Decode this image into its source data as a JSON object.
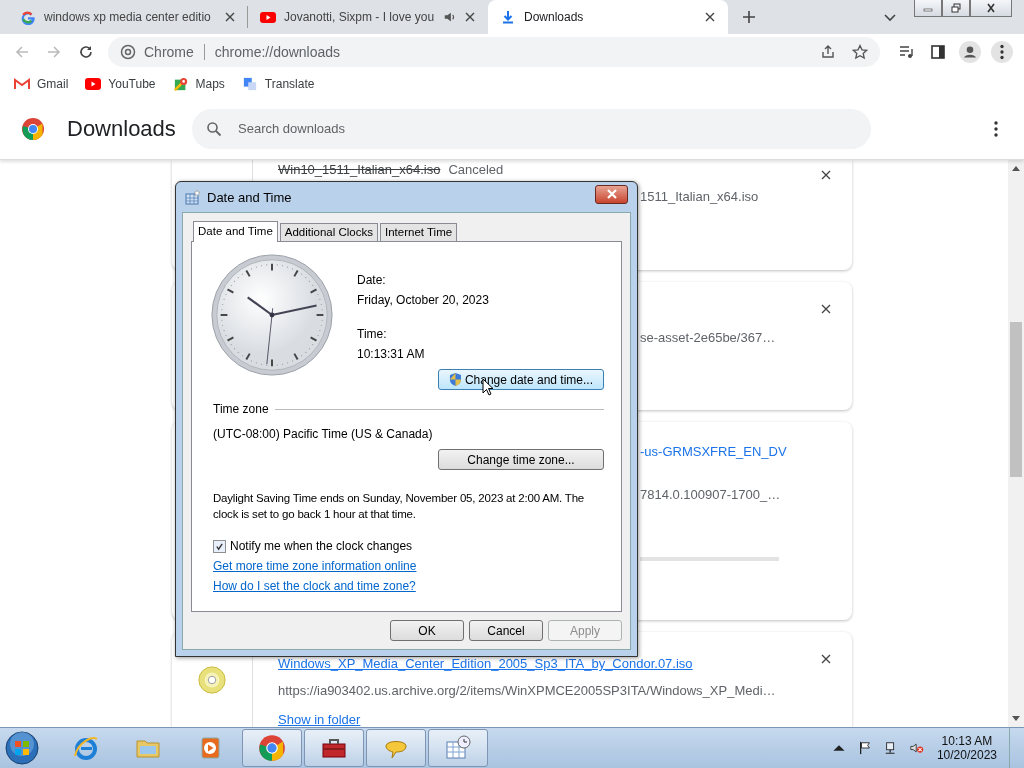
{
  "browser": {
    "tabs": [
      {
        "title": "windows xp media center editio",
        "kind": "google",
        "selected": false,
        "audio": false
      },
      {
        "title": "Jovanotti, Sixpm - I love you",
        "kind": "youtube",
        "selected": false,
        "audio": true
      },
      {
        "title": "Downloads",
        "kind": "download",
        "selected": true,
        "audio": false
      }
    ],
    "address": {
      "site": "Chrome",
      "url": "chrome://downloads"
    },
    "bookmarks": [
      {
        "label": "Gmail",
        "kind": "gmail"
      },
      {
        "label": "YouTube",
        "kind": "youtube"
      },
      {
        "label": "Maps",
        "kind": "maps"
      },
      {
        "label": "Translate",
        "kind": "translate"
      }
    ]
  },
  "page": {
    "title": "Downloads",
    "search": {
      "placeholder": "Search downloads"
    }
  },
  "downloads": [
    {
      "kind": "canceled",
      "name": "Win10_1511_Italian_x64.iso",
      "status": "Canceled",
      "url": "1511_Italian_x64.iso"
    },
    {
      "kind": "partial",
      "url": "se-asset-2e65be/367…"
    },
    {
      "kind": "progress",
      "name": "-us-GRMSXFRE_EN_DV",
      "url": "7814.0.100907-1700_…"
    },
    {
      "kind": "complete",
      "name": "Windows_XP_Media_Center_Edition_2005_Sp3_ITA_by_Condor.07.iso",
      "url": "https://ia903402.us.archive.org/2/items/WinXPMCE2005SP3ITA/Windows_XP_Medi…",
      "action": "Show in folder"
    }
  ],
  "dialog": {
    "title": "Date and Time",
    "tabs": [
      {
        "label": "Date and Time",
        "selected": true
      },
      {
        "label": "Additional Clocks",
        "selected": false
      },
      {
        "label": "Internet Time",
        "selected": false
      }
    ],
    "date_label": "Date:",
    "date": "Friday, October 20, 2023",
    "time_label": "Time:",
    "time": "10:13:31 AM",
    "change_datetime_button": "Change date and time...",
    "time_zone_heading": "Time zone",
    "time_zone": "(UTC-08:00) Pacific Time (US & Canada)",
    "change_zone_button": "Change time zone...",
    "dst_note": "Daylight Saving Time ends on Sunday, November 05, 2023 at 2:00 AM. The clock is set to go back 1 hour at that time.",
    "notify": {
      "label": "Notify me when the clock changes",
      "checked": true
    },
    "links": [
      "Get more time zone information online",
      "How do I set the clock and time zone?"
    ],
    "buttons": [
      {
        "label": "OK",
        "disabled": false
      },
      {
        "label": "Cancel",
        "disabled": false
      },
      {
        "label": "Apply",
        "disabled": true
      }
    ]
  },
  "taskbar": {
    "apps": [
      {
        "kind": "ie",
        "running": false
      },
      {
        "kind": "folder",
        "running": false
      },
      {
        "kind": "media",
        "running": false
      },
      {
        "kind": "chrome",
        "running": true
      },
      {
        "kind": "toolbox",
        "running": true
      },
      {
        "kind": "chat",
        "running": true
      },
      {
        "kind": "calendar",
        "running": true
      }
    ],
    "time": "10:13 AM",
    "date": "10/20/2023"
  }
}
